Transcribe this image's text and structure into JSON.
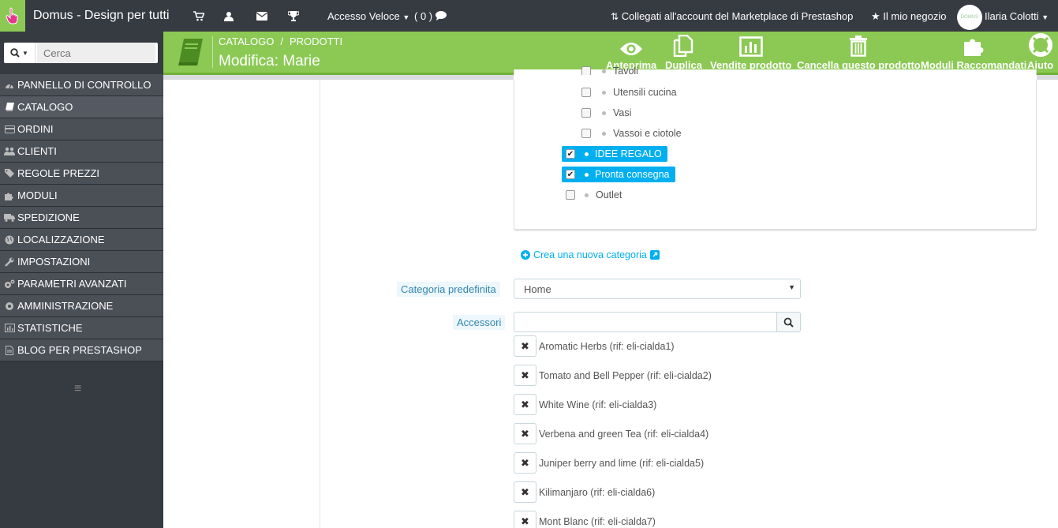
{
  "topbar": {
    "shop_title": "Domus - Design per tutti",
    "quick_access": "Accesso Veloce",
    "notifications": "( 0 )",
    "marketplace": "Collegati all'account del Marketplace di Prestashop",
    "my_shop": "Il mio negozio",
    "user_name": "Ilaria  Colotti"
  },
  "sidebar": {
    "search_placeholder": "Cerca",
    "items": [
      {
        "label": "PANNELLO DI CONTROLLO",
        "icon": "dashboard-icon"
      },
      {
        "label": "CATALOGO",
        "icon": "book-icon"
      },
      {
        "label": "ORDINI",
        "icon": "credit-card-icon"
      },
      {
        "label": "CLIENTI",
        "icon": "users-icon"
      },
      {
        "label": "REGOLE PREZZI",
        "icon": "tags-icon"
      },
      {
        "label": "MODULI",
        "icon": "puzzle-icon"
      },
      {
        "label": "SPEDIZIONE",
        "icon": "truck-icon"
      },
      {
        "label": "LOCALIZZAZIONE",
        "icon": "globe-icon"
      },
      {
        "label": "IMPOSTAZIONI",
        "icon": "wrench-icon"
      },
      {
        "label": "PARAMETRI AVANZATI",
        "icon": "cogs-icon"
      },
      {
        "label": "AMMINISTRAZIONE",
        "icon": "cog-icon"
      },
      {
        "label": "STATISTICHE",
        "icon": "bar-chart-icon"
      },
      {
        "label": "BLOG PER PRESTASHOP",
        "icon": "file-icon"
      }
    ],
    "active_item": "CATALOGO"
  },
  "header": {
    "breadcrumb": [
      "CATALOGO",
      "PRODOTTI"
    ],
    "breadcrumb_sep": "/",
    "title": "Modifica: Marie",
    "toolbar": {
      "preview": "Anteprima",
      "duplicate": "Duplica",
      "sales": "Vendite prodotto",
      "delete": "Cancella questo prodotto",
      "modules": "Moduli Raccomandati",
      "help": "Aiuto"
    }
  },
  "categories_tree": {
    "items": [
      {
        "label": "Tavoli",
        "checked": false
      },
      {
        "label": "Utensili cucina",
        "checked": false
      },
      {
        "label": "Vasi",
        "checked": false
      },
      {
        "label": "Vassoi e ciotole",
        "checked": false
      },
      {
        "label": "IDEE REGALO",
        "checked": true
      },
      {
        "label": "Pronta consegna",
        "checked": true
      },
      {
        "label": "Outlet",
        "checked": false
      }
    ],
    "new_category_link": "Crea una nuova categoria"
  },
  "form": {
    "default_category_label": "Categoria predefinita",
    "default_category_value": "Home",
    "accessories_label": "Accessori",
    "accessories_value": ""
  },
  "accessories": [
    "Aromatic Herbs (rif: eli-cialda1)",
    "Tomato and Bell Pepper (rif: eli-cialda2)",
    "White Wine (rif: eli-cialda3)",
    "Verbena and green Tea (rif: eli-cialda4)",
    "Juniper berry and lime (rif: eli-cialda5)",
    "Kilimanjaro (rif: eli-cialda6)",
    "Mont Blanc (rif: eli-cialda7)"
  ],
  "colors": {
    "accent_green": "#8bc954",
    "selection_blue": "#00aff0",
    "dark_bar": "#363a41"
  }
}
